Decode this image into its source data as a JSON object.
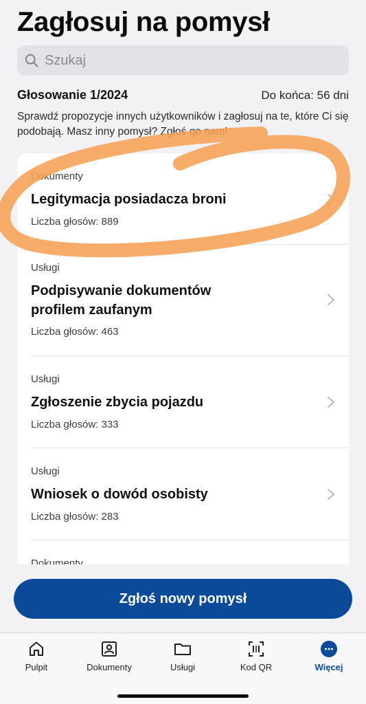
{
  "page": {
    "title": "Zagłosuj na pomysł"
  },
  "search": {
    "placeholder": "Szukaj",
    "icon": "magnifier"
  },
  "poll": {
    "title": "Głosowanie 1/2024",
    "deadline": "Do końca: 56 dni",
    "intro": "Sprawdź propozycje innych użytkowników i zagłosuj na te, które Ci się podobają. Masz inny pomysł? Zgłoś go nam!"
  },
  "ideas": [
    {
      "category": "Dokumenty",
      "name": "Legitymacja posiadacza broni",
      "votes": "Liczba głosów: 889"
    },
    {
      "category": "Usługi",
      "name": "Podpisywanie dokumentów profilem zaufanym",
      "votes": "Liczba głosów: 463"
    },
    {
      "category": "Usługi",
      "name": "Zgłoszenie zbycia pojazdu",
      "votes": "Liczba głosów: 333"
    },
    {
      "category": "Usługi",
      "name": "Wniosek o dowód osobisty",
      "votes": "Liczba głosów: 283"
    },
    {
      "category": "Dokumenty"
    }
  ],
  "cta": {
    "label": "Zgłoś nowy pomysł"
  },
  "tabbar": {
    "tabs": [
      {
        "label": "Pulpit",
        "icon": "home"
      },
      {
        "label": "Dokumenty",
        "icon": "id-card"
      },
      {
        "label": "Usługi",
        "icon": "folder"
      },
      {
        "label": "Kod QR",
        "icon": "qr-scan"
      },
      {
        "label": "Więcej",
        "icon": "more",
        "active": true
      }
    ]
  },
  "colors": {
    "primary": "#0a4a99",
    "background": "#f2f2f4",
    "card": "#ffffff",
    "annotation": "#f7a155"
  }
}
